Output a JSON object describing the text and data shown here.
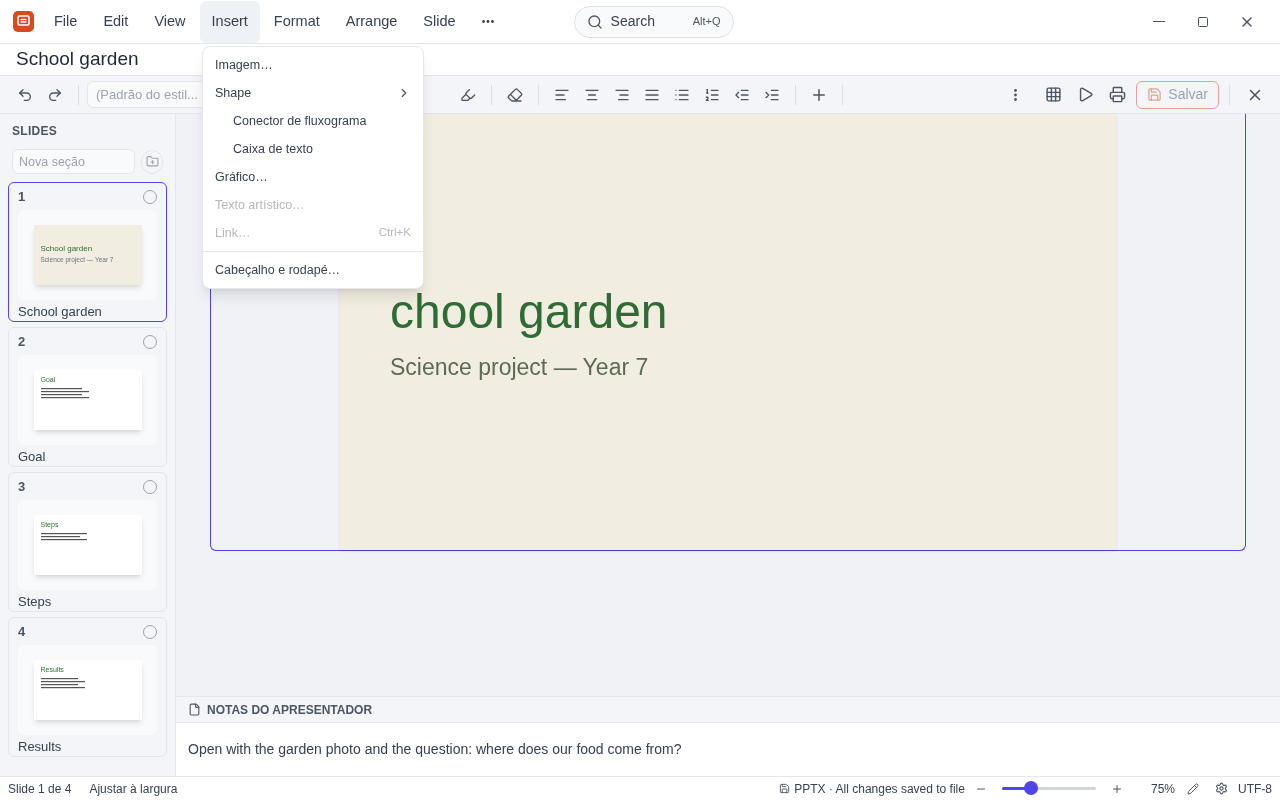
{
  "menubar": [
    {
      "label": "File",
      "selected": false
    },
    {
      "label": "Edit",
      "selected": false
    },
    {
      "label": "View",
      "selected": false
    },
    {
      "label": "Insert",
      "selected": true
    },
    {
      "label": "Format",
      "selected": false
    },
    {
      "label": "Arrange",
      "selected": false
    },
    {
      "label": "Slide",
      "selected": false
    }
  ],
  "search": {
    "placeholder": "Search",
    "shortcut": "Alt+Q"
  },
  "document_title": "School garden",
  "toolbar": {
    "style_select": "(Padrão do estil...",
    "save_button": {
      "label": "Salvar",
      "disabled": true
    }
  },
  "insert_menu": [
    {
      "kind": "item",
      "label": "Imagem…",
      "disabled": false
    },
    {
      "kind": "item",
      "label": "Shape",
      "disabled": false,
      "children": [
        {
          "label": "Conector de fluxograma"
        },
        {
          "label": "Caixa de texto"
        }
      ]
    },
    {
      "kind": "item",
      "label": "Gráfico…",
      "disabled": false
    },
    {
      "kind": "item",
      "label": "Texto artístico…",
      "disabled": true
    },
    {
      "kind": "item",
      "label": "Link…",
      "disabled": true,
      "shortcut": "Ctrl+K"
    },
    {
      "kind": "separator"
    },
    {
      "kind": "item",
      "label": "Cabeçalho e rodapé…",
      "disabled": false
    }
  ],
  "sidebar": {
    "heading": "SLIDES",
    "section_placeholder": "Nova seção",
    "slides": [
      {
        "number": "1",
        "title": "School garden",
        "selected": true,
        "kind": "title",
        "thumb_title": "School garden",
        "thumb_subtitle": "Science project — Year 7"
      },
      {
        "number": "2",
        "title": "Goal",
        "selected": false,
        "kind": "content",
        "thumb_title": "Goal"
      },
      {
        "number": "3",
        "title": "Steps",
        "selected": false,
        "kind": "content",
        "thumb_title": "Steps"
      },
      {
        "number": "4",
        "title": "Results",
        "selected": false,
        "kind": "content",
        "thumb_title": "Results"
      }
    ]
  },
  "slide": {
    "title": "chool garden",
    "subtitle": "Science project — Year 7"
  },
  "notes": {
    "heading": "NOTAS DO APRESENTADOR",
    "text": "Open with the garden photo and the question: where does our food come from?"
  },
  "status_bar": {
    "slide_position": "Slide 1 de 4",
    "fit": "Ajustar à largura",
    "save_status": "PPTX · All changes saved to file",
    "zoom": {
      "level": 0.31,
      "reading": "75%"
    },
    "encoding": "UTF-8"
  }
}
